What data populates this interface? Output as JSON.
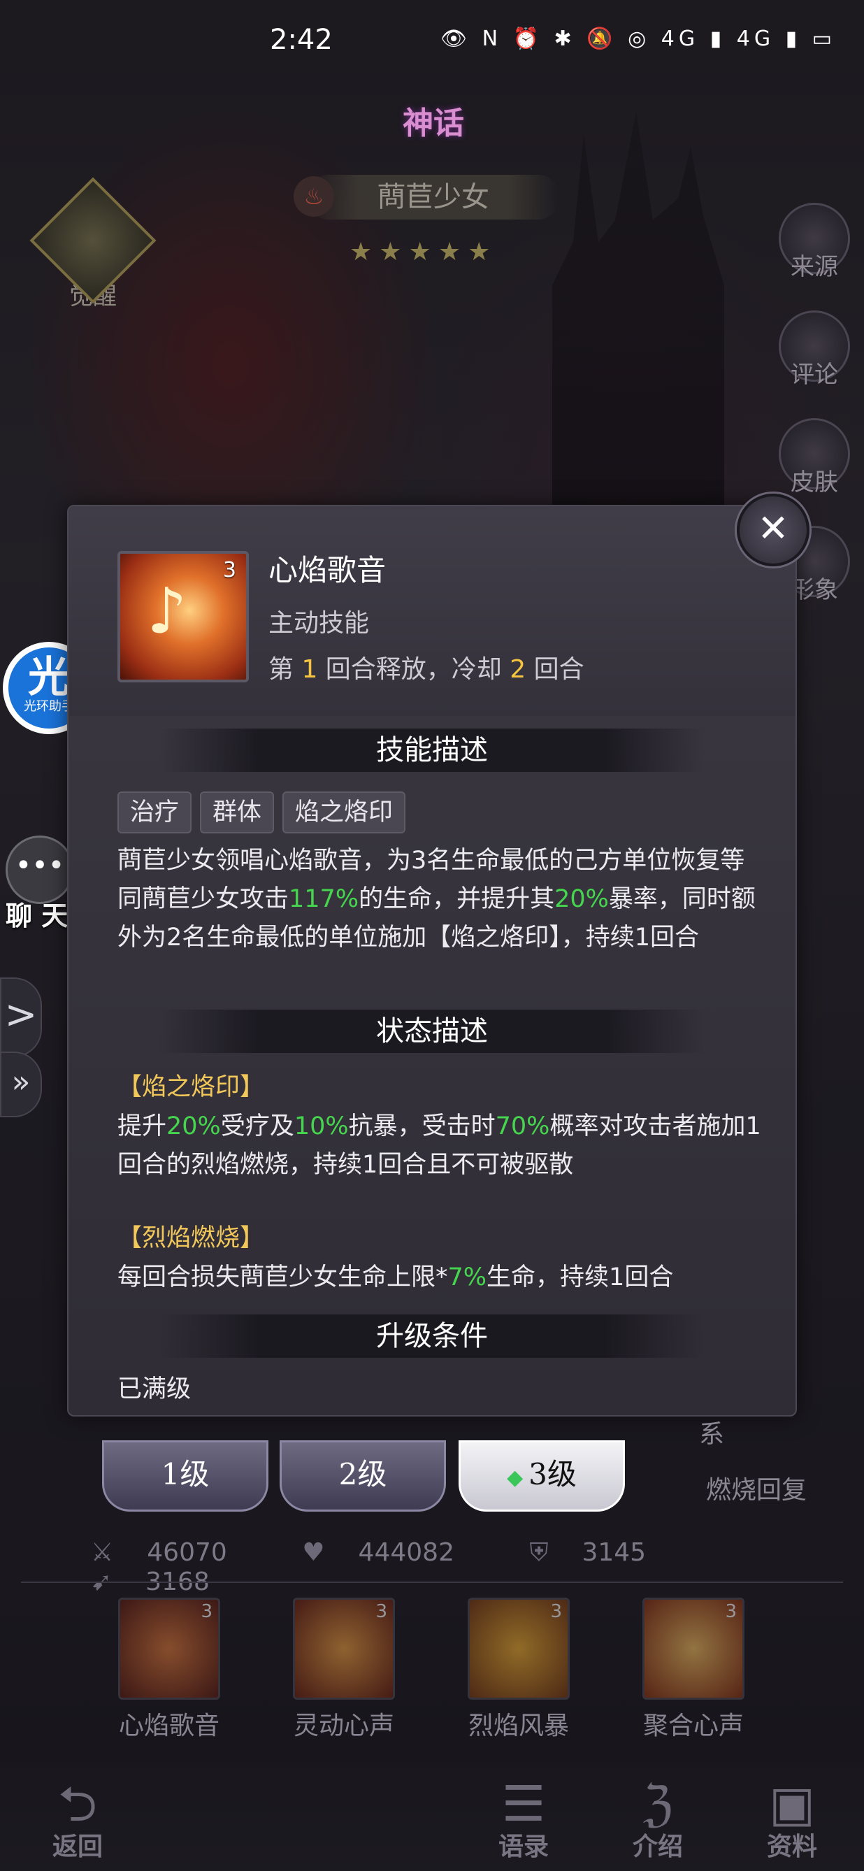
{
  "status_bar": {
    "time": "2:42",
    "icons": "👁 N ⏰ ✱ 🔕 ◎ 4G ▮ 4G ▮ ▭"
  },
  "hero": {
    "rarity": "神话",
    "name": "蔄苣少女",
    "stars": "★★★★★",
    "awaken_label": "觉醒"
  },
  "side_menu": [
    "来源",
    "评论",
    "皮肤",
    "形象"
  ],
  "floating": {
    "assistant_big": "光",
    "assistant_small": "光环助手",
    "chat_label": "聊 天",
    "expand": ">",
    "double": "»"
  },
  "popup": {
    "skill_name": "心焰歌音",
    "skill_level": "3",
    "skill_type": "主动技能",
    "cd_pre": "第 ",
    "cd_round": "1",
    "cd_mid": " 回合释放，冷却 ",
    "cd_count": "2",
    "cd_post": " 回合",
    "section_desc": "技能描述",
    "tags": [
      "治疗",
      "群体",
      "焰之烙印"
    ],
    "desc_p1": "蔄苣少女领唱心焰歌音，为3名生命最低的己方单位恢复等同蔄苣少女攻击",
    "desc_v1": "117%",
    "desc_p2": "的生命，并提升其",
    "desc_v2": "20%",
    "desc_p3": "暴率，同时额外为2名生命最低的单位施加【焰之烙印】，持续1回合",
    "section_state": "状态描述",
    "state1_title": "【焰之烙印】",
    "s1_a": "提升",
    "s1_v1": "20%",
    "s1_b": "受疗及",
    "s1_v2": "10%",
    "s1_c": "抗暴，受击时",
    "s1_v3": "70%",
    "s1_d": "概率对攻击者施加1回合的烈焰燃烧，持续1回合且不可被驱散",
    "state2_title": "【烈焰燃烧】",
    "s2_a": "每回合损失蔄苣少女生命上限*",
    "s2_v1": "7%",
    "s2_b": "生命，持续1回合",
    "section_upgrade": "升级条件",
    "upgrade_text": "已满级",
    "close_icon": "✕"
  },
  "levels": [
    "1级",
    "2级",
    "3级"
  ],
  "right_labels": {
    "relation": "系",
    "burn": "燃烧回复"
  },
  "stats": {
    "attack": "46070",
    "hp": "444082",
    "defense": "3145",
    "speed": "3168"
  },
  "skills": [
    {
      "name": "心焰歌音",
      "lvl": "3"
    },
    {
      "name": "灵动心声",
      "lvl": "3"
    },
    {
      "name": "烈焰风暴",
      "lvl": "3"
    },
    {
      "name": "聚合心声",
      "lvl": "3"
    }
  ],
  "bottom_nav": {
    "back": "返回",
    "voice": "语录",
    "intro": "介绍",
    "data": "资料"
  }
}
